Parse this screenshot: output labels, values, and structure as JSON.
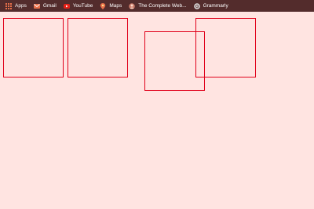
{
  "bookmarks_bar": {
    "items": [
      {
        "label": "Apps",
        "icon": "apps-grid-icon"
      },
      {
        "label": "Gmail",
        "icon": "gmail-icon"
      },
      {
        "label": "YouTube",
        "icon": "youtube-icon"
      },
      {
        "label": "Maps",
        "icon": "maps-pin-icon"
      },
      {
        "label": "The Complete Web...",
        "icon": "course-favicon-icon"
      },
      {
        "label": "Grammarly",
        "icon": "grammarly-icon"
      }
    ]
  },
  "canvas": {
    "background": "#ffe4e1",
    "box_border_color": "#e0001a",
    "box_count": 4
  }
}
